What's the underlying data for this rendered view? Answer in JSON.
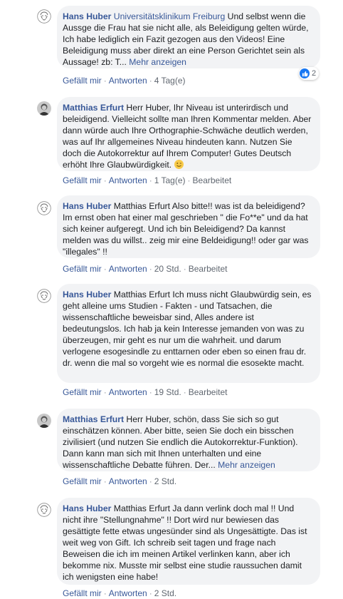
{
  "comments": [
    {
      "author": "Hans Huber",
      "affiliation": "Universitätsklinikum Freiburg",
      "text": "Und selbst wenn die Aussge die Frau hat sie nicht alle, als Beleidigung gelten würde, Ich habe lediglich ein Fazit gezogen aus den Videos! Eine Beleidigung muss aber direkt an eine Person Gerichtet sein als Aussage! zb: T...",
      "more": "Mehr anzeigen",
      "like": "Gefällt mir",
      "reply": "Antworten",
      "time": "4 Tag(e)",
      "reactions": "2"
    },
    {
      "author": "Matthias Erfurt",
      "text": "Herr Huber, Ihr Niveau ist unterirdisch und beleidigend. Vielleicht sollte man Ihren Kommentar melden. Aber dann würde auch Ihre Orthographie-Schwäche deutlich werden, was auf Ihr allgemeines Niveau hindeuten kann. Nutzen Sie doch die Autokorrektur auf Ihrem Computer! Gutes Deutsch erhöht Ihre Glaubwürdigkeit.",
      "like": "Gefällt mir",
      "reply": "Antworten",
      "time": "1 Tag(e)",
      "edited": "Bearbeitet"
    },
    {
      "author": "Hans Huber",
      "text": "Matthias Erfurt Also bitte!! was ist da beleidigend? Im ernst oben hat einer mal geschrieben \" die Fo**e\" und da hat sich keiner aufgeregt. Und ich bin Beleidigend? Da kannst melden was du willst.. zeig mir eine Beldeidigung!! oder gar was \"illegales\" !!",
      "like": "Gefällt mir",
      "reply": "Antworten",
      "time": "20 Std.",
      "edited": "Bearbeitet"
    },
    {
      "author": "Hans Huber",
      "text": "Matthias Erfurt Ich muss nicht Glaubwürdig sein, es geht alleine ums Studien - Fakten - und Tatsachen, die wissenschaftliche beweisbar sind, Alles andere ist bedeutungslos. Ich hab ja kein Interesse jemanden von was zu überzeugen, mir geht es nur um die wahrheit. und darum verlogene esogesindle zu enttarnen oder eben so einen frau dr. dr. wenn die mal so vorgeht wie es normal die esosekte macht.",
      "like": "Gefällt mir",
      "reply": "Antworten",
      "time": "19 Std.",
      "edited": "Bearbeitet"
    },
    {
      "author": "Matthias Erfurt",
      "text": "Herr Huber, schön, dass Sie sich so gut einschätzen können. Aber bitte, seien Sie doch ein bisschen zivilisiert (und nutzen Sie endlich die Autokorrektur-Funktion). Dann kann man sich mit Ihnen unterhalten und eine wissenschaftliche Debatte führen. Der...",
      "more": "Mehr anzeigen",
      "like": "Gefällt mir",
      "reply": "Antworten",
      "time": "2 Std."
    },
    {
      "author": "Hans Huber",
      "text": "Matthias Erfurt Ja dann verlink doch mal !! Und nicht ihre \"Stellungnahme\" !! Dort wird nur bewiesen das gesättigte fette etwas ungesünder sind als Ungesättigte. Das ist weit weg von Gift. Ich schreib seit tagen und frage nach Beweisen die ich im meinen Artikel verlinken kann, aber ich bekomme nix. Musste mir selbst eine studie raussuchen damit ich wenigsten eine habe!",
      "like": "Gefällt mir",
      "reply": "Antworten",
      "time": "2 Std."
    }
  ]
}
